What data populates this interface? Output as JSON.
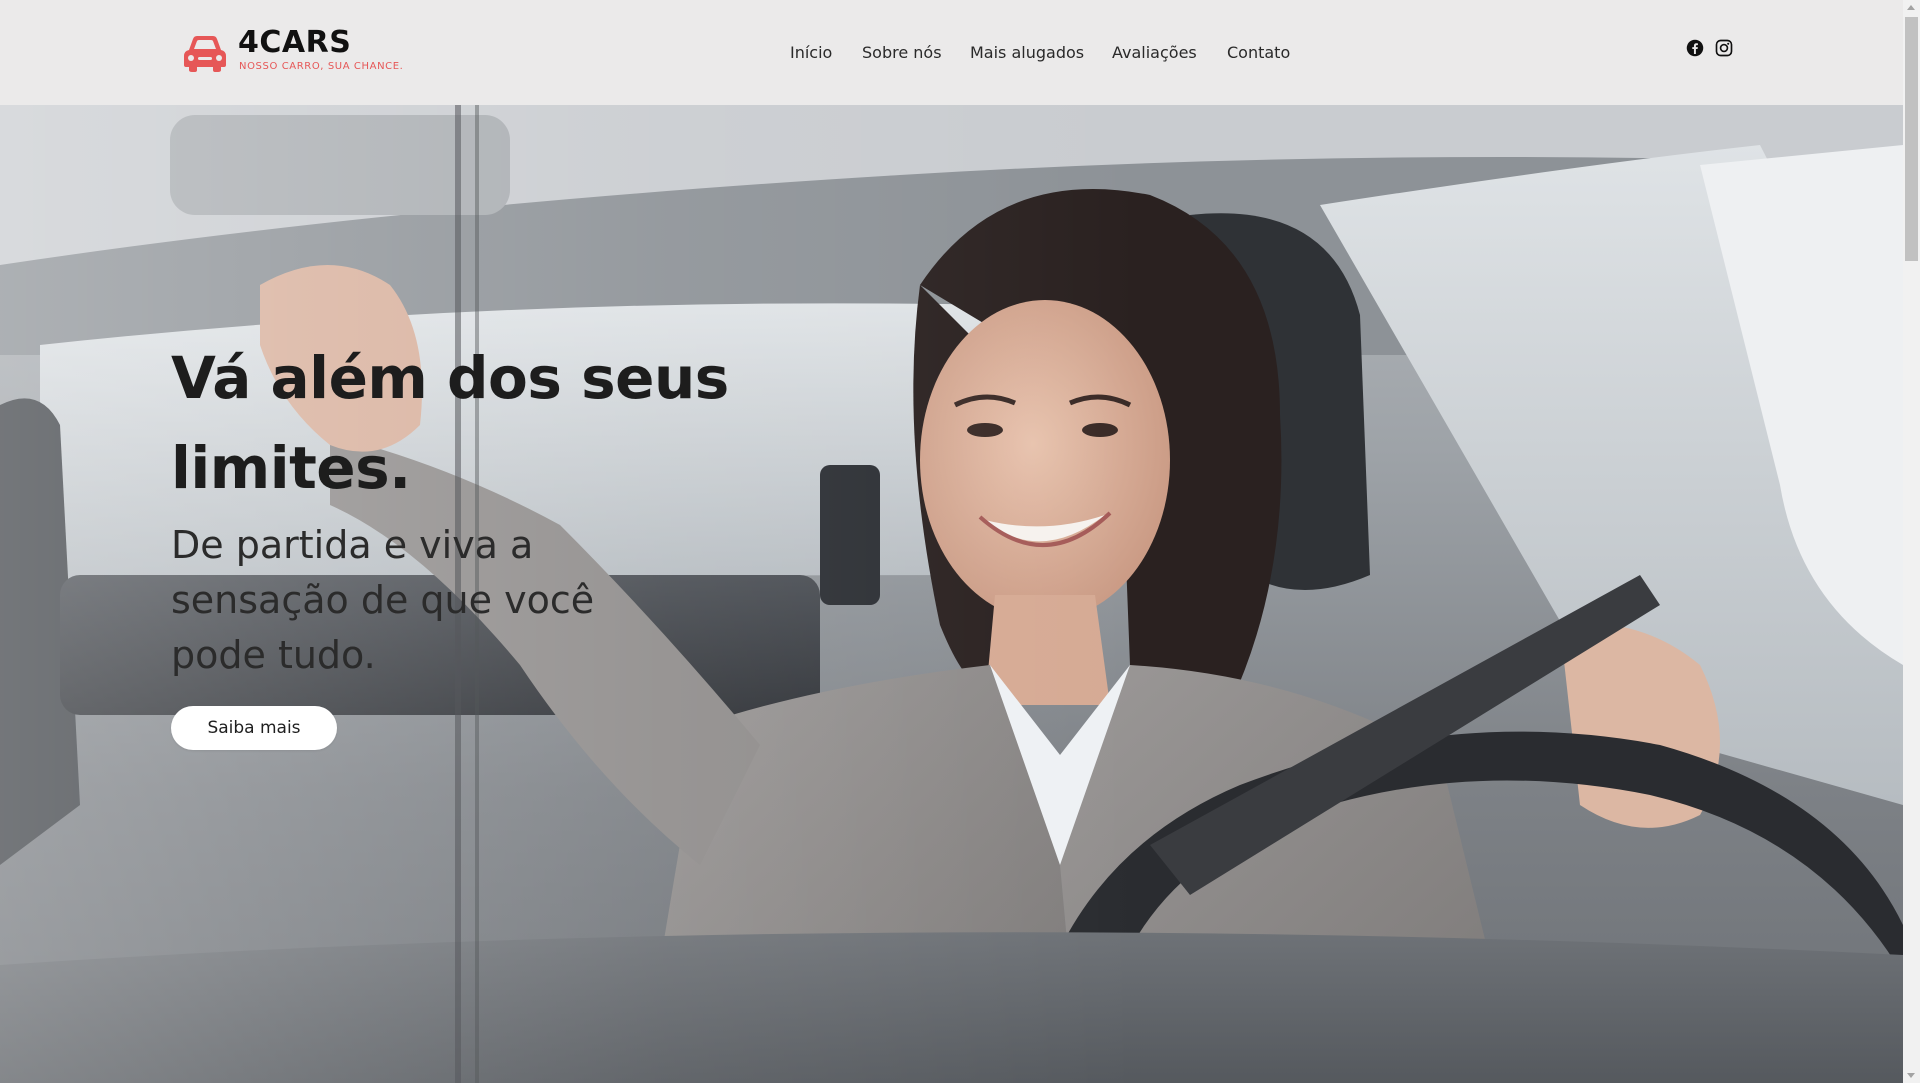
{
  "brand": {
    "name": "4CARS",
    "tagline": "NOSSO CARRO, SUA CHANCE.",
    "accent_color": "#e65757",
    "logo_icon": "car-icon"
  },
  "nav": {
    "items": [
      {
        "label": "Início"
      },
      {
        "label": "Sobre nós"
      },
      {
        "label": "Mais alugados"
      },
      {
        "label": "Avaliações"
      },
      {
        "label": "Contato"
      }
    ]
  },
  "social": {
    "items": [
      {
        "icon": "facebook-icon"
      },
      {
        "icon": "instagram-icon"
      }
    ]
  },
  "hero": {
    "title": "Vá além dos seus limites.",
    "subtitle": "De partida e viva a sensação de que você pode tudo.",
    "button_label": "Saiba mais",
    "background_image": "woman-driving-car-photo"
  }
}
